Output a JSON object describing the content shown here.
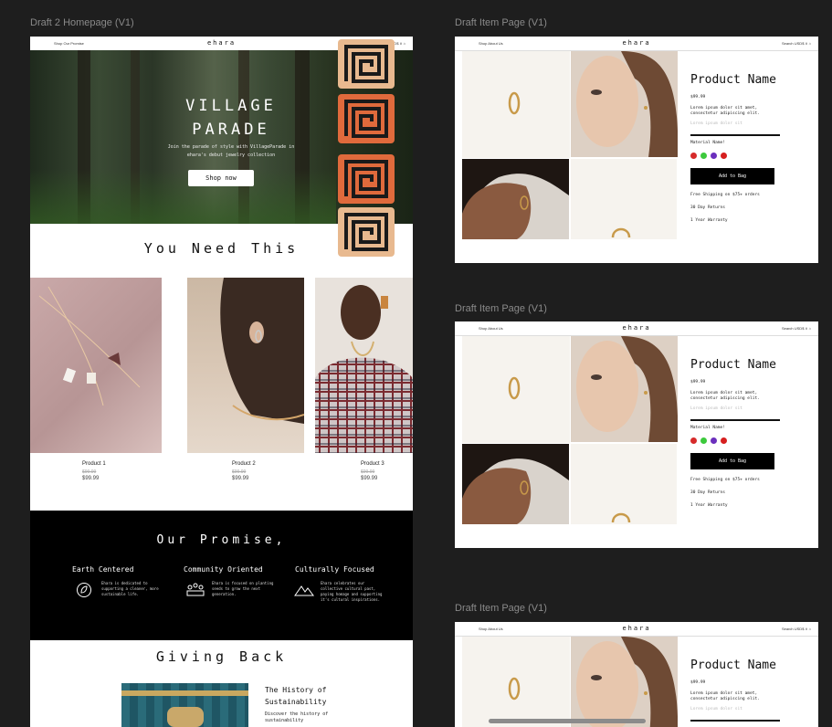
{
  "frames": {
    "homepage_label": "Draft 2 Homepage (V1)",
    "item_label_1": "Draft Item Page (V1)",
    "item_label_2": "Draft Item Page (V1)",
    "item_label_3": "Draft Item Page (V1)"
  },
  "homepage": {
    "nav": {
      "links": "Shop   Our Promise",
      "logo": "ehara",
      "right": "Search   USD$ ∨  ⌂"
    },
    "hero": {
      "title_line1": "VILLAGE",
      "title_line2": "PARADE",
      "subtitle": "Join the parade of style with VillageParade in ehara's debut jewelry collection",
      "cta": "Shop now"
    },
    "section_title": "You Need This",
    "products": [
      {
        "name": "Product 1",
        "old_price": "$99.99",
        "price": "$99.99"
      },
      {
        "name": "Product 2",
        "old_price": "$99.99",
        "price": "$99.99"
      },
      {
        "name": "Product 3",
        "old_price": "$99.99",
        "price": "$99.99"
      }
    ],
    "promise": {
      "title": "Our Promise,",
      "items": [
        {
          "heading": "Earth Centered",
          "text": "Ehara is dedicated to supporting a cleaner, more sustainable life.",
          "icon": "leaf-recycle-icon"
        },
        {
          "heading": "Community Oriented",
          "text": "Ehara is focused on planting seeds to grow the next generation.",
          "icon": "community-icon"
        },
        {
          "heading": "Culturally Focused",
          "text": "Ehara celebrates our collective cultural past, paying homage and supporting it's cultural inspirations.",
          "icon": "mountain-icon"
        }
      ]
    },
    "giving": {
      "title": "Giving Back",
      "heading": "The History of Sustainability",
      "text": "Discover the history of sustainability"
    }
  },
  "item_page": {
    "nav": {
      "links": "Shop   About Us",
      "logo": "ehara",
      "right": "Search   USD$ ∨  ⌂"
    },
    "product_name": "Product Name",
    "price": "$99.99",
    "description": "Lorem ipsum dolor sit amet, consectetur adipiscing elit.",
    "faint": "Lorem ipsum dolor sit",
    "material_label": "Material Name!",
    "swatches": [
      "#d62a2a",
      "#3cc93c",
      "#6b2fbd",
      "#d61f1f"
    ],
    "add_button": "Add to Bag",
    "shipping": "Free Shipping on $75+ orders",
    "returns": "30 Day Returns",
    "warranty": "1 Year Warranty"
  },
  "colors": {
    "canvas": "#1e1e1e",
    "tile_orange": "#e06a3c",
    "tile_tan": "#e8b98f"
  }
}
